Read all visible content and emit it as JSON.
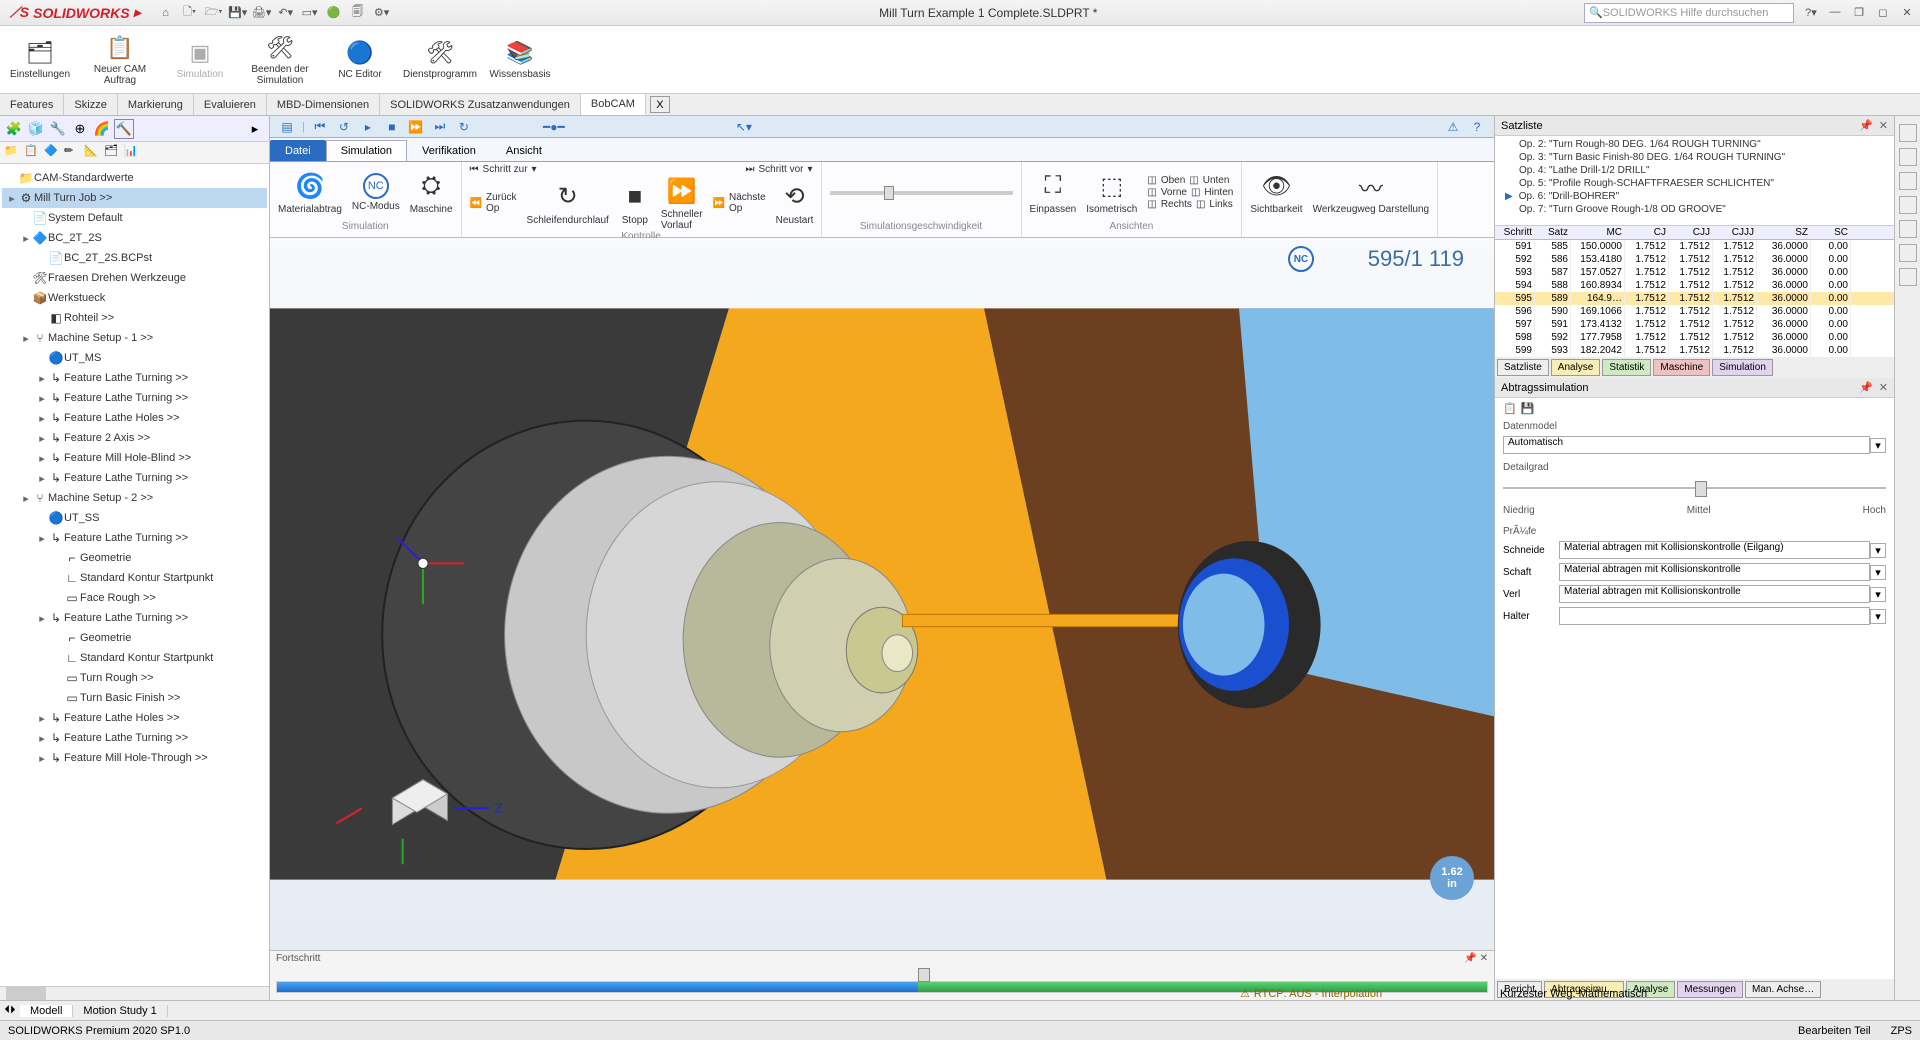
{
  "app": {
    "brand": "SOLIDWORKS",
    "title": "Mill Turn Example 1 Complete.SLDPRT *",
    "search_placeholder": "SOLIDWORKS Hilfe durchsuchen"
  },
  "ribbon_top": [
    {
      "label": "Einstellungen"
    },
    {
      "label": "Neuer CAM Auftrag"
    },
    {
      "label": "Simulation"
    },
    {
      "label": "Beenden der Simulation"
    },
    {
      "label": "NC Editor"
    },
    {
      "label": "Dienstprogramm"
    },
    {
      "label": "Wissensbasis"
    }
  ],
  "cmd_tabs": [
    "Features",
    "Skizze",
    "Markierung",
    "Evaluieren",
    "MBD-Dimensionen",
    "SOLIDWORKS Zusatzanwendungen",
    "BobCAM"
  ],
  "cmd_active": "BobCAM",
  "sim_tabs": {
    "file": "Datei",
    "items": [
      "Simulation",
      "Verifikation",
      "Ansicht"
    ],
    "active": "Simulation"
  },
  "ribbon2": {
    "groups": [
      {
        "label": "Simulation",
        "buttons": [
          "Materialabtrag",
          "NC-Modus",
          "Maschine"
        ]
      },
      {
        "label": "Kontrolle",
        "top": [
          "Schritt zur",
          "Schritt vor"
        ],
        "mid": [
          "Zurück Op",
          "Schleifendurchlauf",
          "Stopp",
          "Schneller Vorlauf",
          "Nächste Op",
          "Neustart"
        ]
      },
      {
        "label": "Simulationsgeschwindigkeit"
      },
      {
        "label": "Ansichten",
        "buttons": [
          "Einpassen",
          "Isometrisch"
        ],
        "side": [
          "Oben",
          "Unten",
          "Vorne",
          "Hinten",
          "Rechts",
          "Links"
        ]
      },
      {
        "label": "",
        "buttons": [
          "Sichtbarkeit",
          "Werkzeugweg Darstellung"
        ]
      }
    ]
  },
  "tree": [
    {
      "ind": 0,
      "ic": "📁",
      "label": "CAM-Standardwerte"
    },
    {
      "ind": 0,
      "ic": "⚙",
      "label": "Mill Turn Job   >>",
      "sel": true,
      "exp": "▸"
    },
    {
      "ind": 1,
      "ic": "📄",
      "label": "System Default"
    },
    {
      "ind": 1,
      "ic": "🔷",
      "label": "BC_2T_2S",
      "exp": "▸"
    },
    {
      "ind": 2,
      "ic": "📄",
      "label": "BC_2T_2S.BCPst"
    },
    {
      "ind": 1,
      "ic": "🛠",
      "label": "Fraesen Drehen Werkzeuge"
    },
    {
      "ind": 1,
      "ic": "📦",
      "label": "Werkstueck"
    },
    {
      "ind": 2,
      "ic": "◧",
      "label": "Rohteil   >>"
    },
    {
      "ind": 1,
      "ic": "⑂",
      "label": "Machine Setup - 1   >>",
      "exp": "▸"
    },
    {
      "ind": 2,
      "ic": "🔵",
      "label": "UT_MS"
    },
    {
      "ind": 2,
      "ic": "↳",
      "label": "Feature Lathe Turning   >>",
      "exp": "▸"
    },
    {
      "ind": 2,
      "ic": "↳",
      "label": "Feature Lathe Turning   >>",
      "exp": "▸"
    },
    {
      "ind": 2,
      "ic": "↳",
      "label": "Feature Lathe Holes   >>",
      "exp": "▸"
    },
    {
      "ind": 2,
      "ic": "↳",
      "label": "Feature 2 Axis   >>",
      "exp": "▸"
    },
    {
      "ind": 2,
      "ic": "↳",
      "label": "Feature Mill Hole-Blind   >>",
      "exp": "▸"
    },
    {
      "ind": 2,
      "ic": "↳",
      "label": "Feature Lathe Turning   >>",
      "exp": "▸"
    },
    {
      "ind": 1,
      "ic": "⑂",
      "label": "Machine Setup - 2   >>",
      "exp": "▸"
    },
    {
      "ind": 2,
      "ic": "🔵",
      "label": "UT_SS"
    },
    {
      "ind": 2,
      "ic": "↳",
      "label": "Feature Lathe Turning   >>",
      "exp": "▸"
    },
    {
      "ind": 3,
      "ic": "⌐",
      "label": "Geometrie"
    },
    {
      "ind": 3,
      "ic": "∟",
      "label": "Standard Kontur Startpunkt"
    },
    {
      "ind": 3,
      "ic": "▭",
      "label": "Face Rough   >>"
    },
    {
      "ind": 2,
      "ic": "↳",
      "label": "Feature Lathe Turning   >>",
      "exp": "▸"
    },
    {
      "ind": 3,
      "ic": "⌐",
      "label": "Geometrie"
    },
    {
      "ind": 3,
      "ic": "∟",
      "label": "Standard Kontur Startpunkt"
    },
    {
      "ind": 3,
      "ic": "▭",
      "label": "Turn Rough   >>"
    },
    {
      "ind": 3,
      "ic": "▭",
      "label": "Turn Basic Finish   >>"
    },
    {
      "ind": 2,
      "ic": "↳",
      "label": "Feature Lathe Holes   >>",
      "exp": "▸"
    },
    {
      "ind": 2,
      "ic": "↳",
      "label": "Feature Lathe Turning   >>",
      "exp": "▸"
    },
    {
      "ind": 2,
      "ic": "↳",
      "label": "Feature Mill Hole-Through   >>",
      "exp": "▸"
    }
  ],
  "viewport": {
    "nc_label": "NC",
    "counter": "595/1 119",
    "dim_val": "1.62",
    "dim_unit": "in",
    "axis_z": "Z"
  },
  "progress": {
    "label": "Fortschritt",
    "pct": 53
  },
  "satzliste": {
    "title": "Satzliste",
    "ops": [
      "Op. 2: \"Turn Rough-80 DEG. 1/64 ROUGH TURNING\"",
      "Op. 3: \"Turn Basic Finish-80 DEG. 1/64 ROUGH TURNING\"",
      "Op. 4: \"Lathe Drill-1/2 DRILL\"",
      "Op. 5: \"Profile Rough-SCHAFTFRAESER SCHLICHTEN\"",
      "Op. 6: \"Drill-BOHRER\"",
      "Op. 7: \"Turn Groove Rough-1/8 OD GROOVE\""
    ],
    "op_active": 4,
    "headers": [
      "Schritt",
      "Satz",
      "MC",
      "CJ",
      "CJJ",
      "CJJJ",
      "SZ",
      "SC"
    ],
    "rows": [
      [
        "591",
        "585",
        "150.0000",
        "1.7512",
        "1.7512",
        "1.7512",
        "36.0000",
        "0.00"
      ],
      [
        "592",
        "586",
        "153.4180",
        "1.7512",
        "1.7512",
        "1.7512",
        "36.0000",
        "0.00"
      ],
      [
        "593",
        "587",
        "157.0527",
        "1.7512",
        "1.7512",
        "1.7512",
        "36.0000",
        "0.00"
      ],
      [
        "594",
        "588",
        "160.8934",
        "1.7512",
        "1.7512",
        "1.7512",
        "36.0000",
        "0.00"
      ],
      [
        "595",
        "589",
        "164.9…",
        "1.7512",
        "1.7512",
        "1.7512",
        "36.0000",
        "0.00"
      ],
      [
        "596",
        "590",
        "169.1066",
        "1.7512",
        "1.7512",
        "1.7512",
        "36.0000",
        "0.00"
      ],
      [
        "597",
        "591",
        "173.4132",
        "1.7512",
        "1.7512",
        "1.7512",
        "36.0000",
        "0.00"
      ],
      [
        "598",
        "592",
        "177.7958",
        "1.7512",
        "1.7512",
        "1.7512",
        "36.0000",
        "0.00"
      ],
      [
        "599",
        "593",
        "182.2042",
        "1.7512",
        "1.7512",
        "1.7512",
        "36.0000",
        "0.00"
      ]
    ],
    "sel_row": 4,
    "tabs": [
      "Satzliste",
      "Analyse",
      "Statistik",
      "Maschine",
      "Simulation"
    ]
  },
  "abtrag": {
    "title": "Abtragssimulation",
    "datenmodel_label": "Datenmodel",
    "datenmodel_value": "Automatisch",
    "detailgrad_label": "Detailgrad",
    "slider_labels": [
      "Niedrig",
      "Mittel",
      "Hoch"
    ],
    "pruefe_label": "PrÃ¼fe",
    "rows": [
      {
        "label": "Schneide",
        "value": "Material abtragen mit Kollisionskontrolle (Eilgang)"
      },
      {
        "label": "Schaft",
        "value": "Material abtragen mit Kollisionskontrolle"
      },
      {
        "label": "Verl",
        "value": "Material abtragen mit Kollisionskontrolle"
      },
      {
        "label": "Halter",
        "value": ""
      }
    ],
    "tabs": [
      "Bericht",
      "Abtragssimu…",
      "Analyse",
      "Messungen",
      "Man. Achse…"
    ]
  },
  "rtcp": "RTCP: AUS - Interpolation",
  "kuerzester": "Kürzester Weg: Mathematisch",
  "bottom_tabs": [
    "Modell",
    "Motion Study 1"
  ],
  "status": {
    "left": "SOLIDWORKS Premium 2020 SP1.0",
    "right1": "Bearbeiten Teil",
    "right2": "ZPS"
  }
}
